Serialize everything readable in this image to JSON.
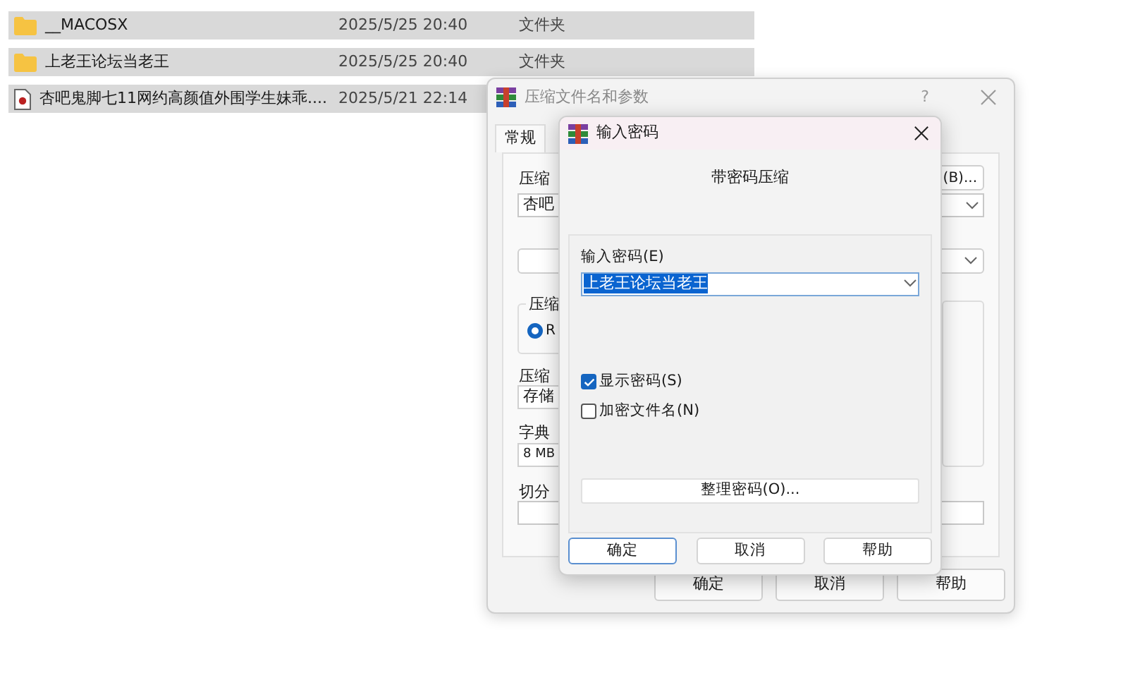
{
  "files": [
    {
      "name": "__MACOSX",
      "date": "2025/5/25 20:40",
      "type": "文件夹",
      "kind": "folder",
      "selected": true
    },
    {
      "name": "上老王论坛当老王",
      "date": "2025/5/25 20:40",
      "type": "文件夹",
      "kind": "folder",
      "selected": true
    },
    {
      "name": "杏吧鬼脚七11网约高颜值外围学生妹乖....",
      "date": "2025/5/21 22:14",
      "kind": "video",
      "selected": true
    }
  ],
  "archive_dialog": {
    "title": "压缩文件名和参数",
    "help": "?",
    "tabs": [
      {
        "label": "常规",
        "selected": true
      }
    ],
    "archive_label": "压缩",
    "archive_value": "杏吧",
    "browse_button": "(B)...",
    "format_label": "压缩",
    "format_option": {
      "label": "R",
      "selected": true
    },
    "method_label": "压缩",
    "method_value": "存储",
    "dict_label": "字典",
    "dict_value": "8 MB",
    "split_label": "切分",
    "buttons": [
      "确定",
      "取消",
      "帮助"
    ]
  },
  "password_dialog": {
    "title": "输入密码",
    "heading": "带密码压缩",
    "password_label": "输入密码(E)",
    "password_value": "上老王论坛当老王",
    "options": [
      {
        "label": "显示密码(S)",
        "checked": true
      },
      {
        "label": "加密文件名(N)",
        "checked": false
      }
    ],
    "organize_button": "整理密码(O)...",
    "buttons": [
      {
        "label": "确定",
        "default": true
      },
      {
        "label": "取消",
        "default": false
      },
      {
        "label": "帮助",
        "default": false
      }
    ]
  }
}
